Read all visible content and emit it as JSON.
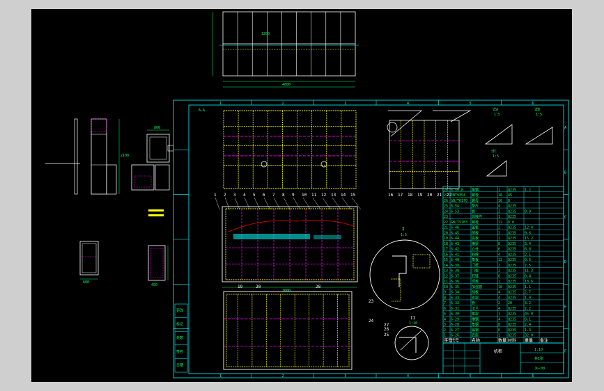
{
  "colors": {
    "background": "#000000",
    "frame": "#00ffff",
    "panel": "#ffffff",
    "frame_yellow": "#ffff00",
    "dash": "#ff00ff",
    "dimension": "#00ff66",
    "hatch": "#00ffff"
  },
  "sheet": {
    "zone_numbers_top": [
      "1",
      "2",
      "3",
      "4",
      "5",
      "6",
      "7",
      "8"
    ],
    "zone_letters_side": [
      "A",
      "B",
      "C",
      "D",
      "E",
      "F"
    ],
    "zone_numbers_bottom": [
      "1",
      "2",
      "3",
      "4",
      "5",
      "6"
    ]
  },
  "views": {
    "front_view_label": "A-A",
    "side_view_title": "左侧视图",
    "detail_1": "I",
    "detail_2": "II",
    "scale_1": "1:5",
    "scale_2": "1:10",
    "detail_views": [
      {
        "label": "详A",
        "scale": "1:5"
      },
      {
        "label": "详B",
        "scale": "1:5"
      },
      {
        "label": "详C",
        "scale": "1:5"
      }
    ]
  },
  "balloons": {
    "top_row": [
      "1",
      "2",
      "3",
      "4",
      "5",
      "6",
      "7",
      "8",
      "9",
      "10",
      "11",
      "12",
      "13",
      "14",
      "15"
    ],
    "side_row": [
      "16",
      "17",
      "18",
      "19",
      "20",
      "21",
      "22"
    ],
    "bottom": [
      "19",
      "20",
      "28"
    ],
    "detail": [
      "23",
      "24",
      "25",
      "26",
      "27"
    ]
  },
  "bom": {
    "rows": [
      [
        "28",
        "6-56-8",
        "角钢",
        "1",
        "Q235",
        "1.2",
        ""
      ],
      [
        "27",
        "JBT9354",
        "螺栓",
        "16",
        "45",
        "",
        ""
      ],
      [
        "26",
        "GB/T6170",
        "螺母",
        "16",
        "8",
        "",
        ""
      ],
      [
        "25",
        "6-54",
        "垫片",
        "4",
        "Q235",
        "",
        ""
      ],
      [
        "24",
        "6-53",
        "板",
        "2",
        "Q235",
        "8.0",
        ""
      ],
      [
        "23",
        "",
        "焊接件",
        "1",
        "Q235",
        "",
        ""
      ],
      [
        "22",
        "GB/T5783",
        "螺栓",
        "12",
        "8.8",
        "",
        ""
      ],
      [
        "21",
        "6-46",
        "盖板",
        "2",
        "Q235",
        "12.4",
        ""
      ],
      [
        "20",
        "6-45",
        "侧板",
        "2",
        "Q235",
        "9.6",
        ""
      ],
      [
        "19",
        "6-44",
        "底板",
        "1",
        "Q235",
        "15.2",
        ""
      ],
      [
        "18",
        "6-43",
        "横梁",
        "8",
        "Q235",
        "3.4",
        ""
      ],
      [
        "17",
        "6-42",
        "立柱",
        "6",
        "Q235",
        "6.8",
        ""
      ],
      [
        "16",
        "6-41",
        "斜撑",
        "4",
        "Q235",
        "2.1",
        ""
      ],
      [
        "15",
        "6-40",
        "角板",
        "12",
        "Q235",
        "0.6",
        ""
      ],
      [
        "14",
        "6-39",
        "门框",
        "2",
        "Q235",
        "7.5",
        ""
      ],
      [
        "13",
        "6-38",
        "门板",
        "2",
        "Q235",
        "11.3",
        ""
      ],
      [
        "12",
        "6-37",
        "铰链",
        "6",
        "Q235",
        "0.4",
        ""
      ],
      [
        "11",
        "6-36",
        "顶板",
        "1",
        "Q235",
        "18.6",
        ""
      ],
      [
        "10",
        "6-35",
        "加强筋",
        "10",
        "Q235",
        "1.1",
        ""
      ],
      [
        "9",
        "6-34",
        "挡板",
        "4",
        "Q235",
        "2.7",
        ""
      ],
      [
        "8",
        "6-33",
        "支架",
        "4",
        "Q235",
        "1.9",
        ""
      ],
      [
        "7",
        "6-32",
        "管",
        "2",
        "20",
        "3.2",
        ""
      ],
      [
        "6",
        "6-31",
        "法兰",
        "4",
        "Q235",
        "2.2",
        ""
      ],
      [
        "5",
        "6-30",
        "框架",
        "1",
        "Q235",
        "45.0",
        ""
      ],
      [
        "4",
        "6-29",
        "槽钢",
        "4",
        "Q235",
        "8.1",
        ""
      ],
      [
        "3",
        "6-28",
        "角钢",
        "8",
        "Q235",
        "2.4",
        ""
      ],
      [
        "2",
        "6-27",
        "扁钢",
        "6",
        "Q235",
        "1.3",
        ""
      ],
      [
        "1",
        "6-26",
        "底座",
        "1",
        "Q235",
        "32.0",
        ""
      ]
    ],
    "header": [
      "序号",
      "代号",
      "名称",
      "数量",
      "材料",
      "重量",
      "备注"
    ]
  },
  "title_block": {
    "drawing_name": "机柜",
    "drawing_no": "JG-00",
    "scale": "1:10",
    "sheet": "共1张"
  },
  "left_revision_block": [
    "更改",
    "标记",
    "处数",
    "签名",
    "日期"
  ],
  "dimensions": {
    "top_width": "4800",
    "top_height": "1200",
    "front_width": "3600",
    "side_height": "2100",
    "small_a": "800",
    "small_b": "600",
    "small_c": "450"
  }
}
